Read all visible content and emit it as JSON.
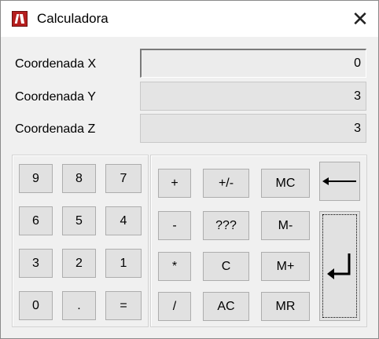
{
  "window": {
    "title": "Calculadora",
    "close_glyph": "✕"
  },
  "fields": [
    {
      "label": "Coordenada X",
      "value": "0"
    },
    {
      "label": "Coordenada Y",
      "value": "3"
    },
    {
      "label": "Coordenada Z",
      "value": "3"
    }
  ],
  "keypad": {
    "digits": [
      "9",
      "8",
      "7",
      "6",
      "5",
      "4",
      "3",
      "2",
      "1",
      "0",
      ".",
      "="
    ]
  },
  "operators": {
    "plus": "+",
    "negate": "+/-",
    "mc": "MC",
    "minus": "-",
    "unknown": "???",
    "m_minus": "M-",
    "multiply": "*",
    "clear": "C",
    "m_plus": "M+",
    "divide": "/",
    "all_clear": "AC",
    "mr": "MR"
  },
  "icons": {
    "backspace": "arrow-left-icon",
    "enter": "enter-return-icon"
  }
}
